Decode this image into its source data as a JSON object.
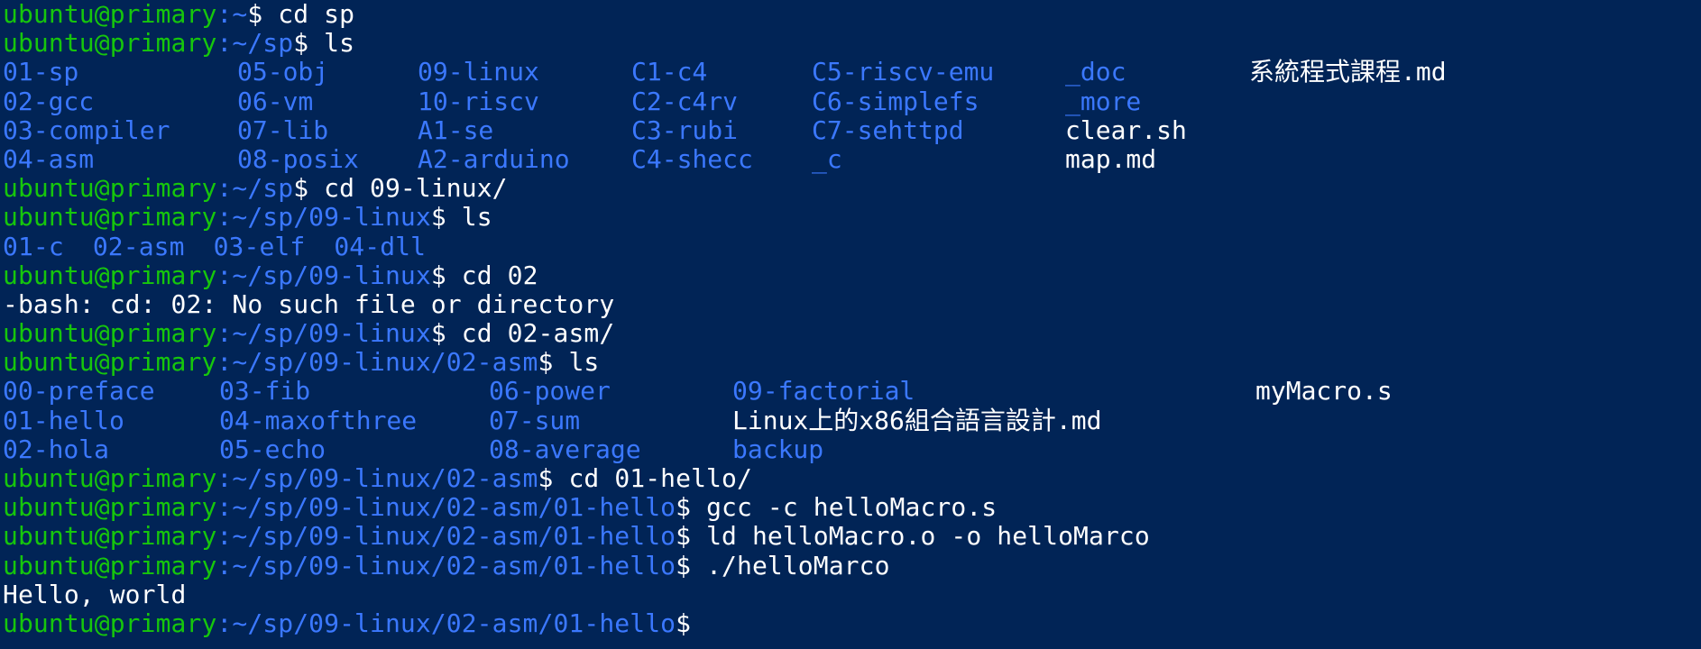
{
  "prompt": {
    "user": "ubuntu@primary",
    "sep": "$"
  },
  "lines": {
    "l0": {
      "path": ":~",
      "cmd": " cd sp"
    },
    "l1": {
      "path": ":~/sp",
      "cmd": " ls"
    },
    "l6": {
      "path": ":~/sp",
      "cmd": " cd 09-linux/"
    },
    "l7": {
      "path": ":~/sp/09-linux",
      "cmd": " ls"
    },
    "l9": {
      "path": ":~/sp/09-linux",
      "cmd": " cd 02"
    },
    "l11": {
      "path": ":~/sp/09-linux",
      "cmd": " cd 02-asm/"
    },
    "l12": {
      "path": ":~/sp/09-linux/02-asm",
      "cmd": " ls"
    },
    "l16": {
      "path": ":~/sp/09-linux/02-asm",
      "cmd": " cd 01-hello/"
    },
    "l17": {
      "path": ":~/sp/09-linux/02-asm/01-hello",
      "cmd": " gcc -c helloMacro.s"
    },
    "l18": {
      "path": ":~/sp/09-linux/02-asm/01-hello",
      "cmd": " ld helloMacro.o -o helloMarco"
    },
    "l19": {
      "path": ":~/sp/09-linux/02-asm/01-hello",
      "cmd": " ./helloMarco"
    },
    "l21": {
      "path": ":~/sp/09-linux/02-asm/01-hello",
      "cmd": ""
    }
  },
  "ls_sp": [
    [
      "01-sp",
      "05-obj",
      "09-linux",
      "C1-c4",
      "C5-riscv-emu",
      "_doc",
      "系統程式課程.md"
    ],
    [
      "02-gcc",
      "06-vm",
      "10-riscv",
      "C2-c4rv",
      "C6-simplefs",
      "_more",
      ""
    ],
    [
      "03-compiler",
      "07-lib",
      "A1-se",
      "C3-rubi",
      "C7-sehttpd",
      "clear.sh",
      ""
    ],
    [
      "04-asm",
      "08-posix",
      "A2-arduino",
      "C4-shecc",
      "_c",
      "map.md",
      ""
    ]
  ],
  "ls_linux": [
    "01-c",
    "02-asm",
    "03-elf",
    "04-dll"
  ],
  "ls_asm": [
    [
      "00-preface",
      "03-fib",
      "06-power",
      "09-factorial",
      "myMacro.s"
    ],
    [
      "01-hello",
      "04-maxofthree",
      "07-sum",
      "Linux上的x86組合語言設計.md",
      ""
    ],
    [
      "02-hola",
      "05-echo",
      "08-average",
      "backup",
      ""
    ]
  ],
  "errors": {
    "cd02": "-bash: cd: 02: No such file or directory"
  },
  "output": {
    "hello": "Hello, world"
  },
  "colors": {
    "background": "#012456",
    "user": "#16c60c",
    "path": "#3b78ff",
    "directory": "#3b78ff",
    "text": "#ffffff"
  }
}
